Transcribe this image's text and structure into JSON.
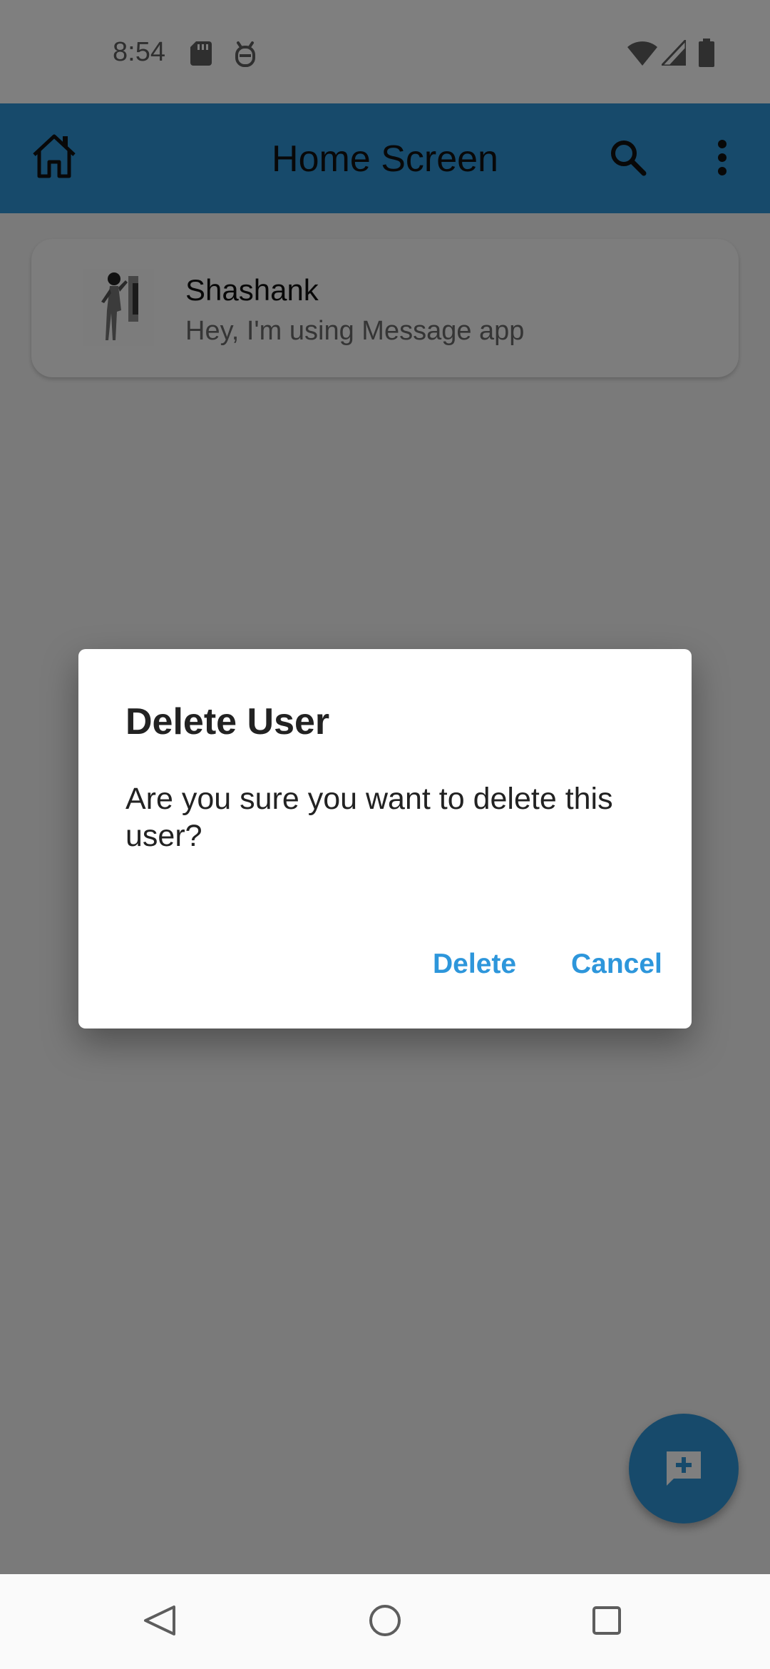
{
  "status_bar": {
    "time": "8:54",
    "icons": [
      "sd-card-icon",
      "debug-icon",
      "wifi-icon",
      "cell-signal-icon",
      "battery-icon"
    ]
  },
  "app_bar": {
    "title": "Home Screen",
    "icons": [
      "home-icon",
      "search-icon",
      "more-vert-icon"
    ],
    "color": "#2f94d6"
  },
  "users": [
    {
      "name": "Shashank",
      "status": "Hey, I'm using Message app"
    }
  ],
  "fab": {
    "icon": "add-comment-icon"
  },
  "dialog": {
    "title": "Delete User",
    "message": "Are you sure you want to delete this user?",
    "confirm_label": "Delete",
    "cancel_label": "Cancel",
    "button_color": "#2d96db"
  },
  "nav_bar": {
    "icons": [
      "back-icon",
      "home-nav-icon",
      "recents-icon"
    ]
  }
}
